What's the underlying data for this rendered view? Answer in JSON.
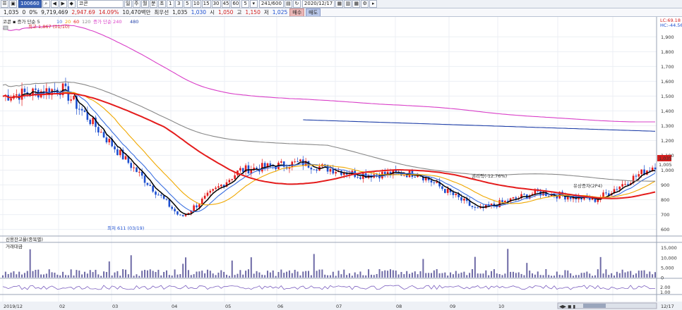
{
  "toolbar1": {
    "code": "100660",
    "name": "코콘",
    "period_buttons": [
      "1",
      "3",
      "5",
      "10",
      "15",
      "30",
      "45",
      "60"
    ],
    "count_value": "5",
    "range_value": "241/600",
    "date_value": "2020/12/17"
  },
  "toolbar2": {
    "price": "1,035",
    "change": "0",
    "change_pct": "0%",
    "volume": "9,719,469",
    "vol_ratio": "2,947.69",
    "vol_ratio_pct": "14.09%",
    "amount": "10,470백만",
    "type": "최우선",
    "best_price": "1,035",
    "best_bid": "1,030",
    "high_label": "시",
    "open": "1,050",
    "high_label2": "고",
    "high": "1,150",
    "low_label": "저",
    "low": "1,025",
    "buy_label": "매수",
    "sell_label": "매도"
  },
  "legend": {
    "main": "코콘 ▪ 증가 단순 5",
    "ma": [
      "10",
      "20",
      "60",
      "120"
    ],
    "ma_tail": "증가 단순 240",
    "ma_tail_val": "480",
    "lc": "LC:69.18",
    "hc": "HC:-44.56"
  },
  "annotations": {
    "high_label": "최고 1,867 (01/10)",
    "low_label": "최저 611 (03/19)",
    "peak_label": "권리락(-12.76%)",
    "right_label": "유상증자(2P4)"
  },
  "y_axis_labels": [
    "1,900",
    "1,800",
    "1,700",
    "1,600",
    "1,500",
    "1,400",
    "1,300",
    "1,200",
    "1,100",
    "1,000",
    "900",
    "800",
    "700",
    "600"
  ],
  "price_tags": {
    "current": "1,035",
    "ma": "1,005"
  },
  "credit_panel": {
    "title": "신용잔고율(종목별)"
  },
  "volume_panel": {
    "title": "거래대금",
    "labels": [
      "15,000",
      "10,000",
      "5,000",
      "0"
    ],
    "unit": "1,000"
  },
  "volume_ratio_labels": [
    "2.00",
    "1.00"
  ],
  "date_labels": [
    "2019/12",
    "02",
    "03",
    "04",
    "05",
    "06",
    "07",
    "08",
    "09",
    "10",
    "11",
    "12",
    "12/17"
  ],
  "chart_data": {
    "type": "candlestick",
    "title": "",
    "ylim": [
      560,
      1930
    ],
    "x_periods": [
      "2019/12",
      "02",
      "03",
      "04",
      "05",
      "06",
      "07",
      "08",
      "09",
      "10",
      "11",
      "12"
    ],
    "series": [
      {
        "name": "5",
        "color": "#000000"
      },
      {
        "name": "10",
        "color": "#3a6fe0"
      },
      {
        "name": "20",
        "color": "#f0a800"
      },
      {
        "name": "60",
        "color": "#e41c1c"
      },
      {
        "name": "120",
        "color": "#888888"
      },
      {
        "name": "240",
        "color": "#d93fc8"
      },
      {
        "name": "480",
        "color": "#1f3fa8"
      }
    ],
    "monthly_close_approx": [
      1500,
      1550,
      1100,
      680,
      1000,
      1050,
      970,
      980,
      730,
      850,
      800,
      1035
    ]
  }
}
